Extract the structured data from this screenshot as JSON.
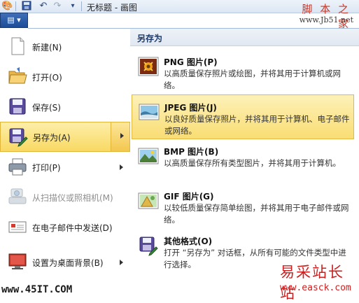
{
  "window": {
    "title": "无标题 - 画图"
  },
  "app_button": {
    "label": "▤ ▾"
  },
  "watermark_top": {
    "line1": "脚 本 之 家",
    "line2": "www.Jb51.net"
  },
  "menu": {
    "items": [
      {
        "label": "新建(N)",
        "icon": "new-file-icon",
        "disabled": false,
        "active": false,
        "has_submenu": false
      },
      {
        "label": "打开(O)",
        "icon": "open-folder-icon",
        "disabled": false,
        "active": false,
        "has_submenu": false
      },
      {
        "label": "保存(S)",
        "icon": "save-disk-icon",
        "disabled": false,
        "active": false,
        "has_submenu": false
      },
      {
        "label": "另存为(A)",
        "icon": "save-as-icon",
        "disabled": false,
        "active": true,
        "has_submenu": true
      },
      {
        "label": "打印(P)",
        "icon": "printer-icon",
        "disabled": false,
        "active": false,
        "has_submenu": true
      },
      {
        "label": "从扫描仪或照相机(M)",
        "icon": "scanner-camera-icon",
        "disabled": true,
        "active": false,
        "has_submenu": false
      },
      {
        "label": "在电子邮件中发送(D)",
        "icon": "email-icon",
        "disabled": false,
        "active": false,
        "has_submenu": false
      },
      {
        "label": "设置为桌面背景(B)",
        "icon": "desktop-background-icon",
        "disabled": false,
        "active": false,
        "has_submenu": true
      }
    ]
  },
  "submenu": {
    "header": "另存为",
    "items": [
      {
        "title": "PNG 图片(P)",
        "desc": "以高质量保存照片或绘图，并将其用于计算机或网络。",
        "icon": "png-image-icon",
        "active": false
      },
      {
        "title": "JPEG 图片(J)",
        "desc": "以良好质量保存照片，并将其用于计算机、电子邮件或网络。",
        "icon": "jpeg-image-icon",
        "active": true
      },
      {
        "title": "BMP 图片(B)",
        "desc": "以高质量保存所有类型图片，并将其用于计算机。",
        "icon": "bmp-image-icon",
        "active": false
      },
      {
        "title": "GIF 图片(G)",
        "desc": "以较低质量保存简单绘图，并将其用于电子邮件或网络。",
        "icon": "gif-image-icon",
        "active": false
      },
      {
        "title": "其他格式(O)",
        "desc": "打开 “另存为” 对话框，从所有可能的文件类型中进行选择。",
        "icon": "other-formats-icon",
        "active": false
      }
    ]
  },
  "watermark_bottom_left": "www.45IT.COM",
  "watermark_bottom_right": {
    "line1": "易采站长站",
    "line2": "www.easck.com"
  },
  "colors": {
    "highlight": "#f9d963",
    "highlight_border": "#e1b53a",
    "app_button": "#1e4c98"
  }
}
